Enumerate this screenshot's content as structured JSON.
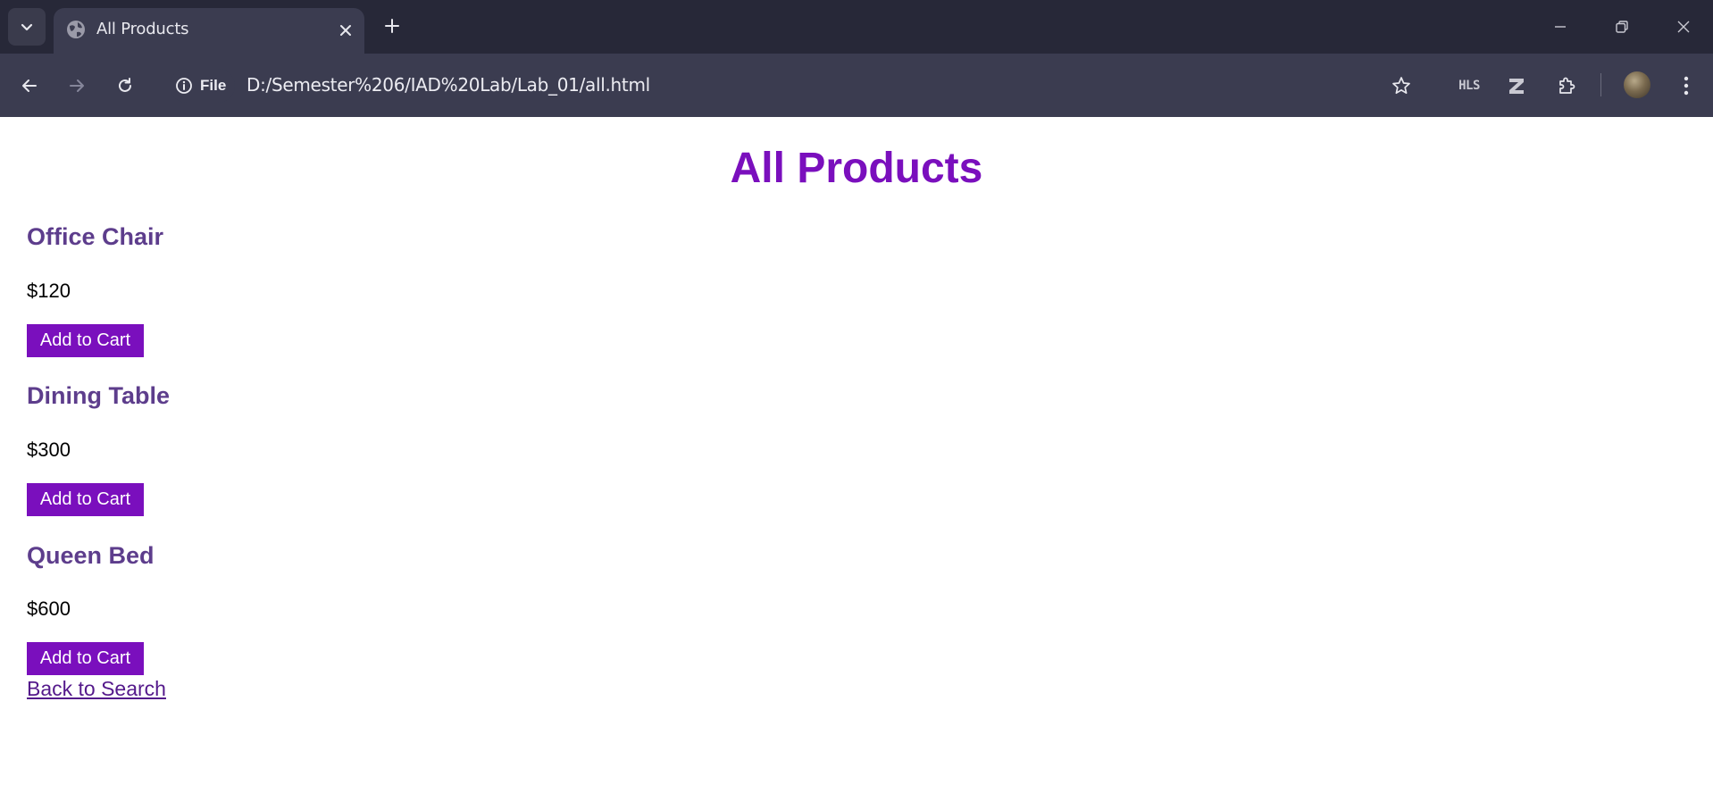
{
  "browser": {
    "tab_title": "All Products",
    "site_info_label": "File",
    "url": "D:/Semester%206/IAD%20Lab/Lab_01/all.html",
    "extension_hls_label": "HLS"
  },
  "page": {
    "title": "All Products",
    "products": [
      {
        "name": "Office Chair",
        "price": "$120",
        "button_label": "Add to Cart"
      },
      {
        "name": "Dining Table",
        "price": "$300",
        "button_label": "Add to Cart"
      },
      {
        "name": "Queen Bed",
        "price": "$600",
        "button_label": "Add to Cart"
      }
    ],
    "back_link": "Back to Search"
  },
  "colors": {
    "title": "#7a0fbd",
    "product_name": "#5d3d8c",
    "button_bg": "#7a0fbd",
    "link": "#54198b"
  }
}
